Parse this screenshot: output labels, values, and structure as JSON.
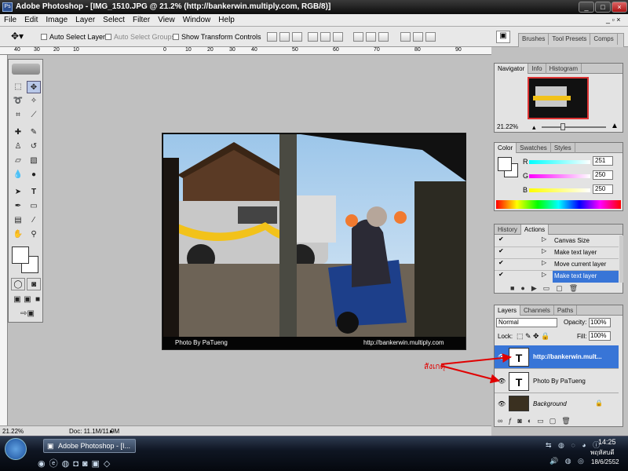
{
  "window": {
    "title": "Adobe Photoshop - [IMG_1510.JPG @ 21.2% (http://bankerwin.multiply.com, RGB/8)]",
    "logo": "Ps"
  },
  "menu": [
    "File",
    "Edit",
    "Image",
    "Layer",
    "Select",
    "Filter",
    "View",
    "Window",
    "Help"
  ],
  "options": {
    "auto_select_layer": "Auto Select Layer",
    "auto_select_groups": "Auto Select Groups",
    "show_transform_controls": "Show Transform Controls"
  },
  "palette_well": [
    "Brushes",
    "Tool Presets",
    "Comps"
  ],
  "ruler_ticks": [
    "40",
    "30",
    "20",
    "10",
    "0",
    "10",
    "20",
    "30",
    "40",
    "50",
    "60",
    "70",
    "80",
    "90"
  ],
  "canvas": {
    "caption_left": "Photo By PaTueng",
    "caption_right": "http://bankerwin.multiply.com"
  },
  "navigator": {
    "tabs": [
      "Navigator",
      "Info",
      "Histogram"
    ],
    "zoom": "21.22%"
  },
  "color": {
    "tabs": [
      "Color",
      "Swatches",
      "Styles"
    ],
    "r_label": "R",
    "g_label": "G",
    "b_label": "B",
    "r": "251",
    "g": "250",
    "b": "250"
  },
  "history": {
    "tabs": [
      "History",
      "Actions"
    ],
    "items": [
      "Canvas Size",
      "Make text layer",
      "Move current layer",
      "Make text layer"
    ]
  },
  "layers": {
    "tabs": [
      "Layers",
      "Channels",
      "Paths"
    ],
    "blend_mode": "Normal",
    "opacity_label": "Opacity:",
    "opacity": "100%",
    "lock_label": "Lock:",
    "fill_label": "Fill:",
    "fill": "100%",
    "items": [
      "http://bankerwin.mult...",
      "Photo By PaTueng",
      "Background"
    ],
    "annotation": "สังเกตุ"
  },
  "status": {
    "zoom": "21.22%",
    "doc": "Doc: 11.1M/11.9M"
  },
  "taskbar": {
    "task": "Adobe Photoshop - [I...",
    "time": "14:25",
    "day": "พฤหัสบดี",
    "date": "18/6/2552"
  },
  "colors": {
    "highlight": "#3875d7",
    "annotation": "#e00000"
  }
}
